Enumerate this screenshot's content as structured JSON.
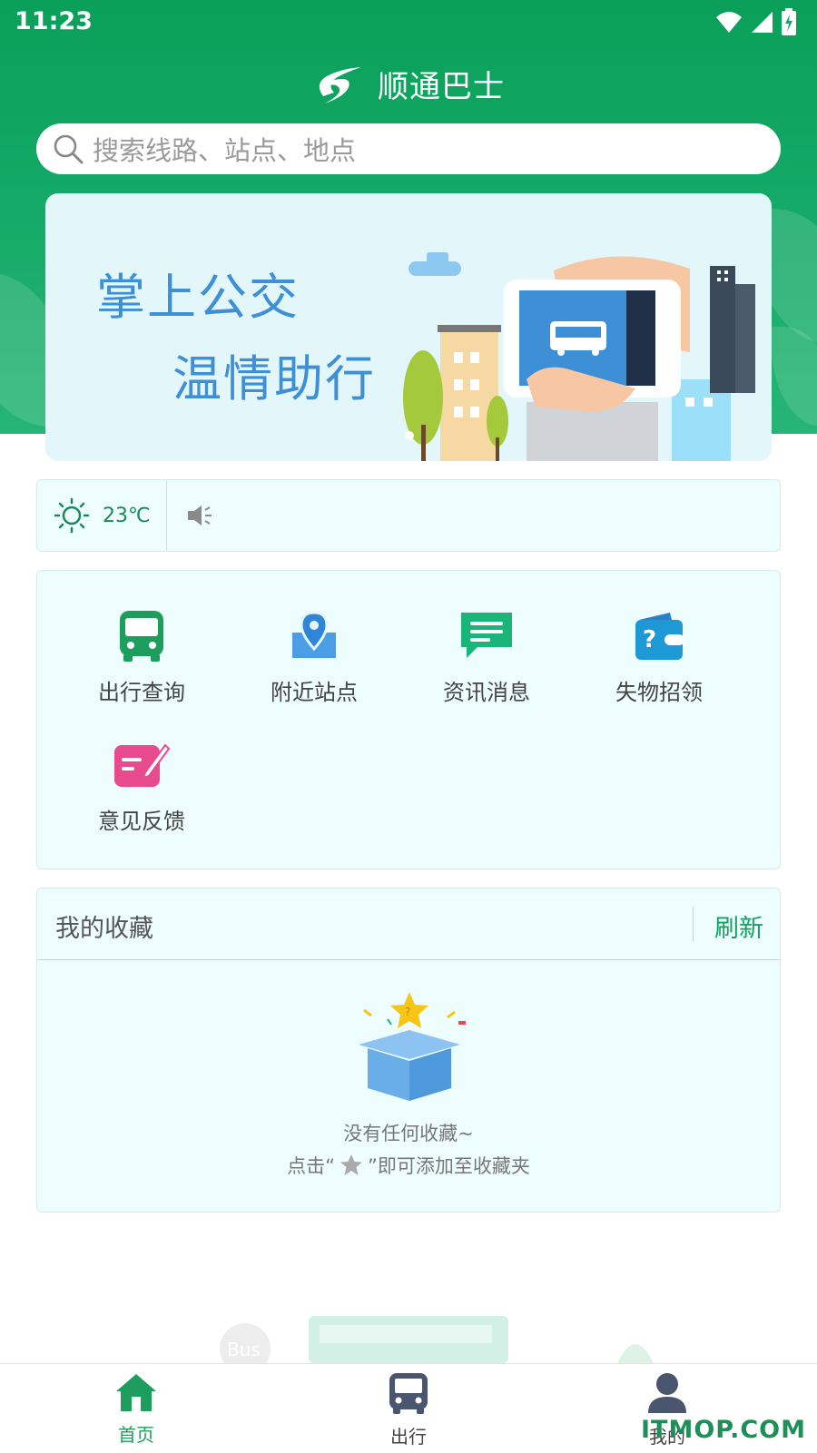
{
  "status_bar": {
    "time": "11:23"
  },
  "header": {
    "app_title": "顺通巴士"
  },
  "search": {
    "placeholder": "搜索线路、站点、地点"
  },
  "banner": {
    "line1": "掌上公交",
    "line2": "温情助行"
  },
  "weather": {
    "temperature": "23℃",
    "weather_icon": "sun-icon",
    "notice_icon": "speaker-icon"
  },
  "features": [
    {
      "label": "出行查询",
      "icon": "bus-icon"
    },
    {
      "label": "附近站点",
      "icon": "location-pin-icon"
    },
    {
      "label": "资讯消息",
      "icon": "message-icon"
    },
    {
      "label": "失物招领",
      "icon": "lost-found-wallet-icon"
    },
    {
      "label": "意见反馈",
      "icon": "feedback-edit-icon"
    }
  ],
  "favorites": {
    "title": "我的收藏",
    "refresh_label": "刷新",
    "empty_line1": "没有任何收藏~",
    "empty_line2_prefix": "点击“",
    "empty_line2_suffix": "”即可添加至收藏夹"
  },
  "decoration_bus_text": "Bus",
  "tabbar": {
    "items": [
      {
        "label": "首页",
        "icon": "home-icon",
        "active": true
      },
      {
        "label": "出行",
        "icon": "bus-icon",
        "active": false
      },
      {
        "label": "我的",
        "icon": "user-icon",
        "active": false
      }
    ]
  },
  "watermark": "ITMOP.COM",
  "colors": {
    "primary_green": "#12a865",
    "banner_text_blue": "#3d8fd6",
    "card_bg": "#eefdfd",
    "feedback_pink": "#e84a8e"
  }
}
